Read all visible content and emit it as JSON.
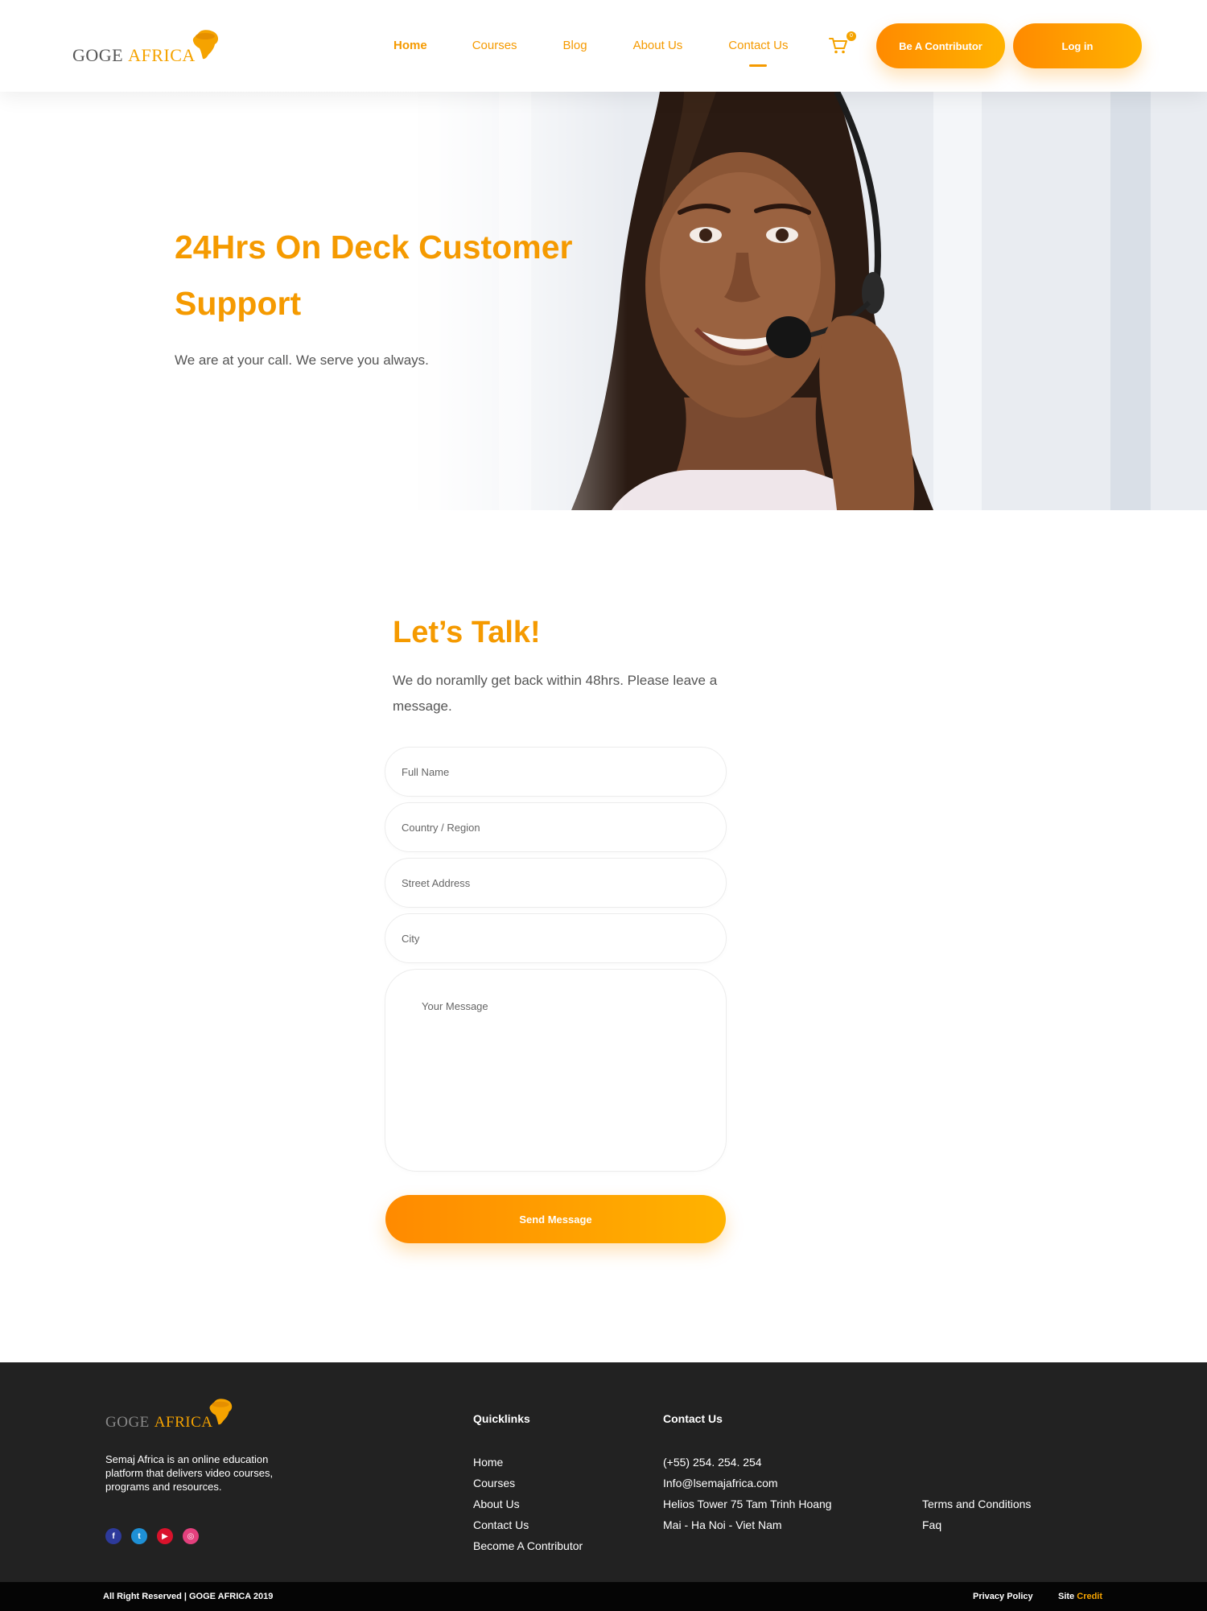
{
  "brand": {
    "name_part1": "GOGE",
    "name_part2": "AFRICA",
    "accent_color": "#f5a300",
    "icon": "africa-map-hat-icon"
  },
  "nav": {
    "items": [
      {
        "label": "Home",
        "state": "active"
      },
      {
        "label": "Courses"
      },
      {
        "label": "Blog"
      },
      {
        "label": "About Us"
      },
      {
        "label": "Contact Us",
        "state": "current-underlined"
      }
    ],
    "cart_icon": "shopping-cart-icon",
    "cart_count": "0",
    "contributor_button": "Be A Contributor",
    "login_button": "Log in"
  },
  "hero": {
    "title": "24Hrs On Deck Customer Support",
    "subtitle": "We are at your call. We serve you always.",
    "image": "support-agent-with-headset"
  },
  "contact": {
    "title": "Let’s Talk!",
    "subtitle": "We do noramlly get back within 48hrs. Please leave a message.",
    "fields": {
      "full_name": "Full Name",
      "country": "Country / Region",
      "street": "Street Address",
      "city": "City",
      "message": "Your Message"
    },
    "send_button": "Send Message"
  },
  "footer": {
    "about": "Semaj Africa is an online education platform that delivers video courses, programs and resources.",
    "social": [
      "facebook-icon",
      "twitter-icon",
      "youtube-icon",
      "dribbble-icon"
    ],
    "quicklinks_title": "Quicklinks",
    "quicklinks": [
      "Home",
      "Courses",
      "About Us",
      "Contact Us",
      "Become A Contributor"
    ],
    "contact_title": "Contact Us",
    "contact_lines": [
      "(+55) 254. 254. 254",
      "Info@lsemajafrica.com",
      "Helios Tower 75 Tam Trinh Hoang",
      "Mai - Ha Noi - Viet Nam"
    ],
    "legal_links": [
      "Terms and Conditions",
      "Faq"
    ],
    "copyright": "All Right Reserved | GOGE AFRICA 2019",
    "privacy": "Privacy Policy",
    "site_label": "Site",
    "credit_label": "Credit"
  }
}
